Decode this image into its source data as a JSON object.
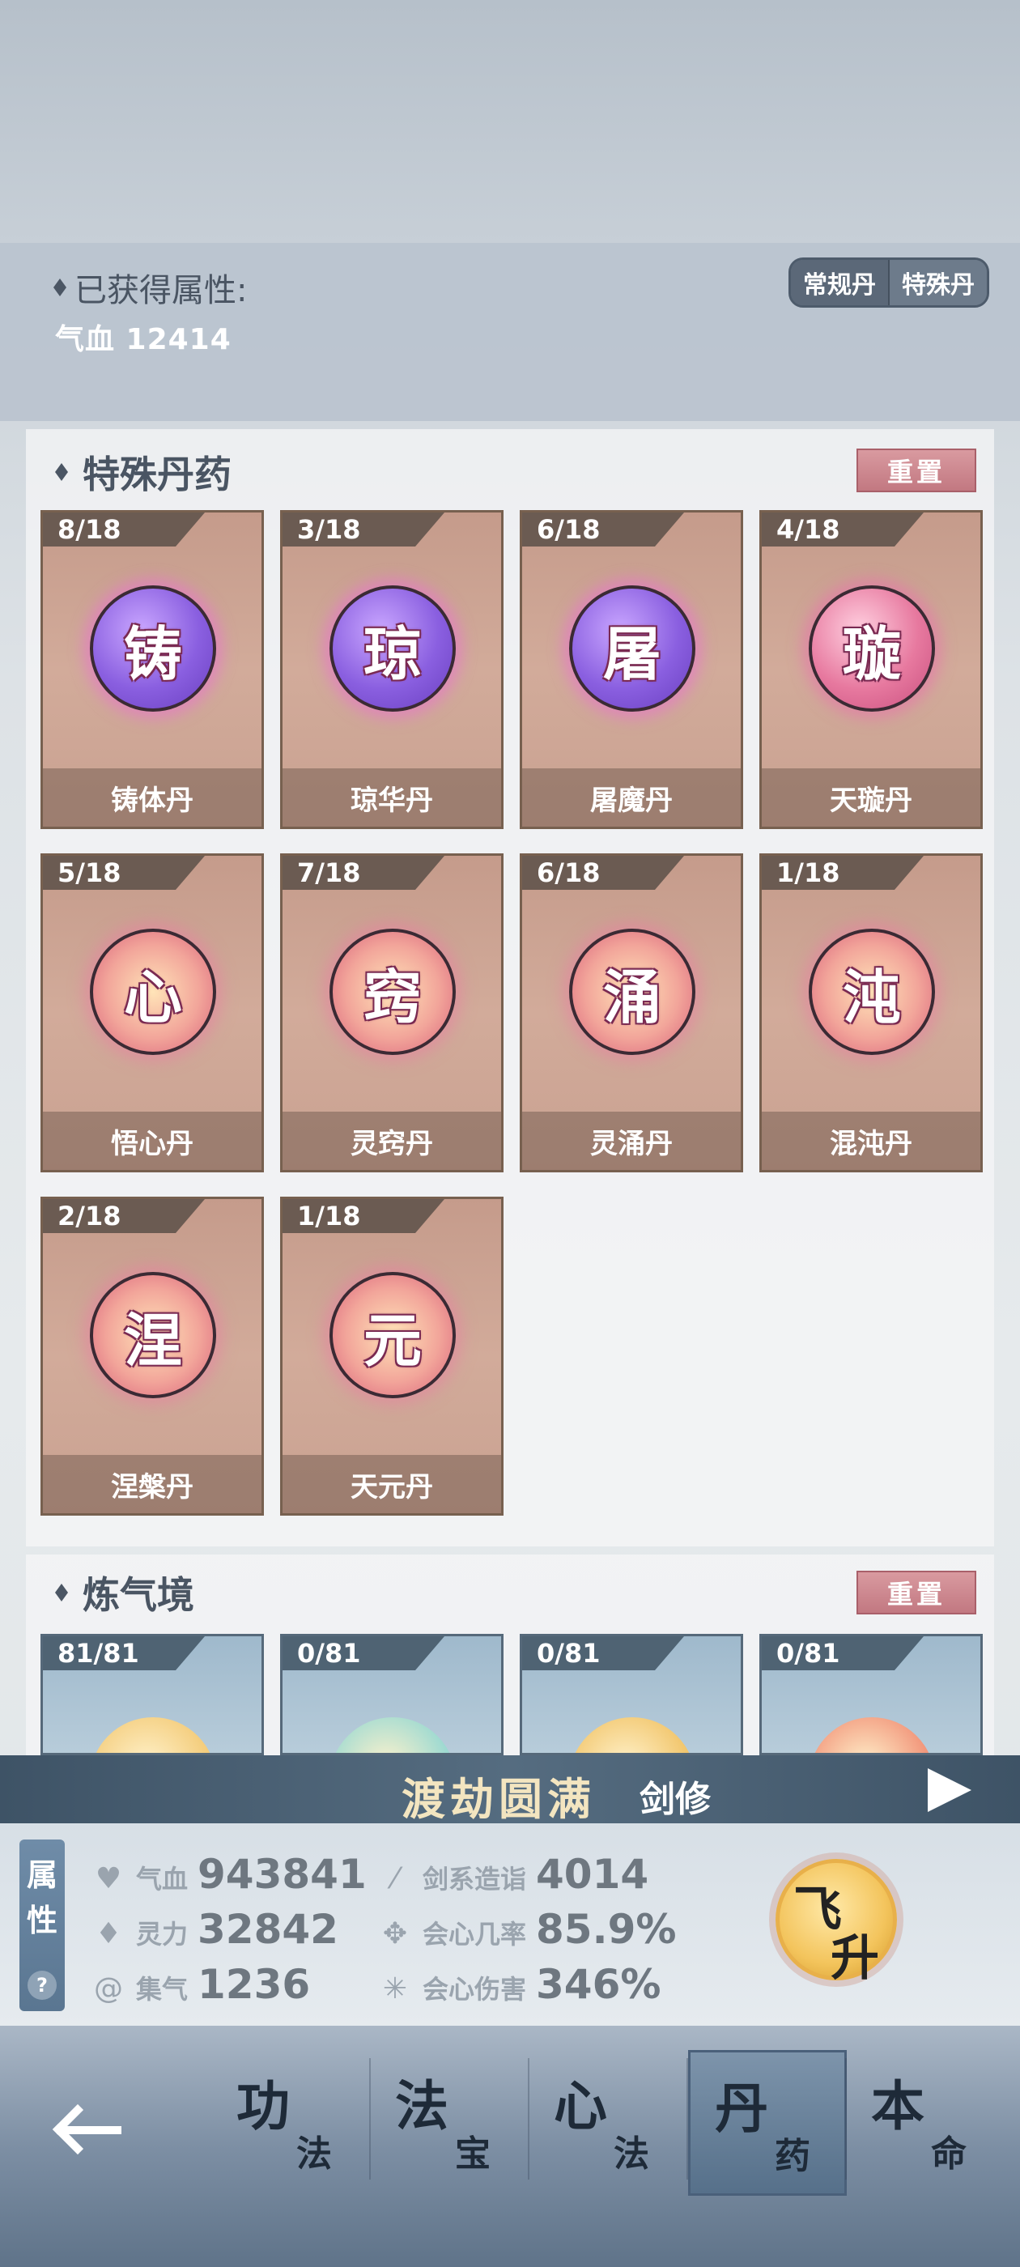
{
  "attributes_panel": {
    "heading": "已获得属性:",
    "value": "气血 12414",
    "toggle": {
      "regular": "常规丹",
      "special": "特殊丹",
      "selected": "特殊丹"
    }
  },
  "special_pills": {
    "title": "特殊丹药",
    "reset_label": "重置",
    "items": [
      {
        "count": "8/18",
        "glyph": "铸",
        "name": "铸体丹",
        "color": "purple"
      },
      {
        "count": "3/18",
        "glyph": "琼",
        "name": "琼华丹",
        "color": "purple"
      },
      {
        "count": "6/18",
        "glyph": "屠",
        "name": "屠魔丹",
        "color": "purple"
      },
      {
        "count": "4/18",
        "glyph": "璇",
        "name": "天璇丹",
        "color": "pink"
      },
      {
        "count": "5/18",
        "glyph": "心",
        "name": "悟心丹",
        "color": "peach"
      },
      {
        "count": "7/18",
        "glyph": "窍",
        "name": "灵窍丹",
        "color": "peach"
      },
      {
        "count": "6/18",
        "glyph": "涌",
        "name": "灵涌丹",
        "color": "peach"
      },
      {
        "count": "1/18",
        "glyph": "沌",
        "name": "混沌丹",
        "color": "peach"
      },
      {
        "count": "2/18",
        "glyph": "涅",
        "name": "涅槃丹",
        "color": "peach"
      },
      {
        "count": "1/18",
        "glyph": "元",
        "name": "天元丹",
        "color": "peach"
      }
    ]
  },
  "qi_refining": {
    "title": "炼气境",
    "reset_label": "重置",
    "items": [
      {
        "count": "81/81",
        "orb_color": "#f2c770"
      },
      {
        "count": "0/81",
        "orb_color": "#8fd6d2"
      },
      {
        "count": "0/81",
        "orb_color": "#f0c060"
      },
      {
        "count": "0/81",
        "orb_color": "#f08a70"
      }
    ]
  },
  "realm_bar": {
    "realm": "渡劫圆满",
    "class": "剑修"
  },
  "stats": {
    "tab_label_1": "属",
    "tab_label_2": "性",
    "help": "?",
    "qixue": {
      "icon": "heart-icon",
      "label": "气血",
      "value": "943841"
    },
    "lingli": {
      "icon": "drop-icon",
      "label": "灵力",
      "value": "32842"
    },
    "jiqi": {
      "icon": "swirl-icon",
      "label": "集气",
      "value": "1236"
    },
    "sword": {
      "icon": "sword-icon",
      "label": "剑系造诣",
      "value": "4014"
    },
    "crit_rate": {
      "icon": "knot-icon",
      "label": "会心几率",
      "value": "85.9%"
    },
    "crit_dmg": {
      "icon": "burst-icon",
      "label": "会心伤害",
      "value": "346%"
    },
    "ascend": {
      "t1": "飞",
      "t2": "升"
    }
  },
  "bottom_nav": {
    "items": [
      {
        "big": "功",
        "small": "法"
      },
      {
        "big": "法",
        "small": "宝"
      },
      {
        "big": "心",
        "small": "法"
      },
      {
        "big": "丹",
        "small": "药"
      },
      {
        "big": "本",
        "small": "命"
      }
    ],
    "active": "丹药"
  }
}
